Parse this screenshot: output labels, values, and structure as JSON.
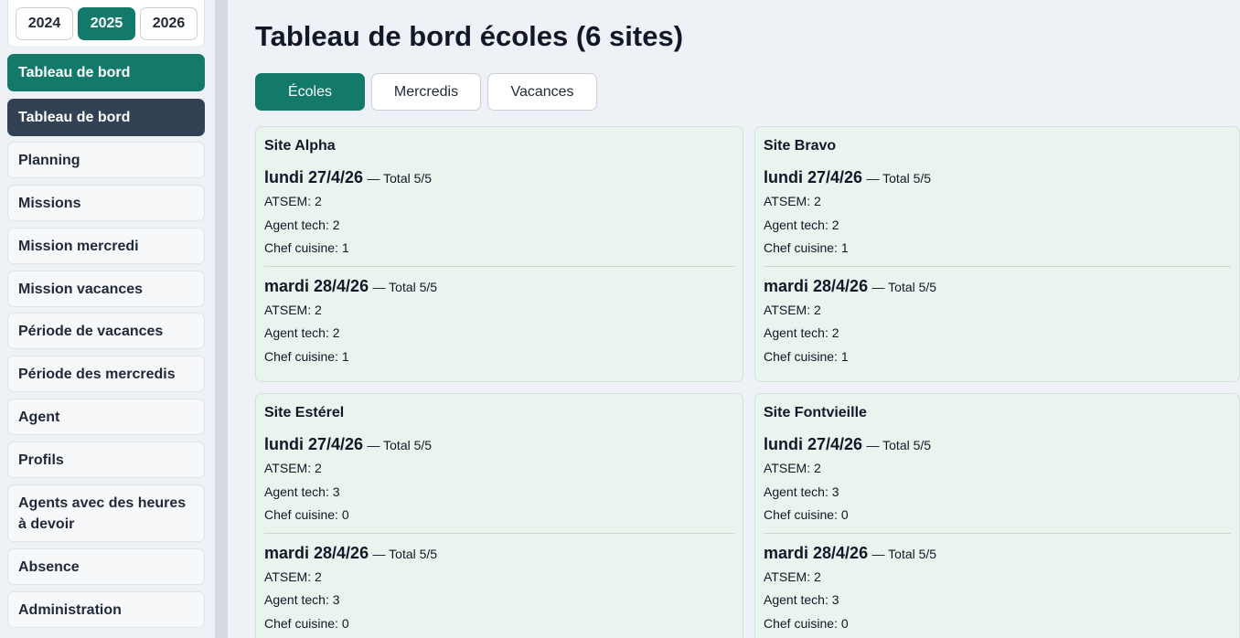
{
  "years": [
    "2024",
    "2025",
    "2026"
  ],
  "active_year": "2025",
  "sidebar": {
    "items": [
      {
        "label": "Tableau de bord",
        "style": "primary"
      },
      {
        "label": "Tableau de bord",
        "style": "dark"
      },
      {
        "label": "Planning",
        "style": "normal"
      },
      {
        "label": "Missions",
        "style": "normal"
      },
      {
        "label": "Mission mercredi",
        "style": "normal"
      },
      {
        "label": "Mission vacances",
        "style": "normal"
      },
      {
        "label": "Période de vacances",
        "style": "normal"
      },
      {
        "label": "Période des mercredis",
        "style": "normal"
      },
      {
        "label": "Agent",
        "style": "normal"
      },
      {
        "label": "Profils",
        "style": "normal"
      },
      {
        "label": "Agents avec des heures à devoir",
        "style": "normal"
      },
      {
        "label": "Absence",
        "style": "normal"
      },
      {
        "label": "Administration",
        "style": "normal"
      }
    ]
  },
  "page_title": "Tableau de bord écoles (6 sites)",
  "tabs": [
    {
      "label": "Écoles",
      "active": true
    },
    {
      "label": "Mercredis",
      "active": false
    },
    {
      "label": "Vacances",
      "active": false
    }
  ],
  "sites": [
    {
      "name": "Site Alpha",
      "days": [
        {
          "day": "lundi 27/4/26",
          "total": "— Total 5/5",
          "lines": [
            "ATSEM: 2",
            "Agent tech: 2",
            "Chef cuisine: 1"
          ]
        },
        {
          "day": "mardi 28/4/26",
          "total": "— Total 5/5",
          "lines": [
            "ATSEM: 2",
            "Agent tech: 2",
            "Chef cuisine: 1"
          ]
        }
      ]
    },
    {
      "name": "Site Bravo",
      "days": [
        {
          "day": "lundi 27/4/26",
          "total": "— Total 5/5",
          "lines": [
            "ATSEM: 2",
            "Agent tech: 2",
            "Chef cuisine: 1"
          ]
        },
        {
          "day": "mardi 28/4/26",
          "total": "— Total 5/5",
          "lines": [
            "ATSEM: 2",
            "Agent tech: 2",
            "Chef cuisine: 1"
          ]
        }
      ]
    },
    {
      "name": "Site Estérel",
      "days": [
        {
          "day": "lundi 27/4/26",
          "total": "— Total 5/5",
          "lines": [
            "ATSEM: 2",
            "Agent tech: 3",
            "Chef cuisine: 0"
          ]
        },
        {
          "day": "mardi 28/4/26",
          "total": "— Total 5/5",
          "lines": [
            "ATSEM: 2",
            "Agent tech: 3",
            "Chef cuisine: 0"
          ]
        }
      ]
    },
    {
      "name": "Site Fontvieille",
      "days": [
        {
          "day": "lundi 27/4/26",
          "total": "— Total 5/5",
          "lines": [
            "ATSEM: 2",
            "Agent tech: 3",
            "Chef cuisine: 0"
          ]
        },
        {
          "day": "mardi 28/4/26",
          "total": "— Total 5/5",
          "lines": [
            "ATSEM: 2",
            "Agent tech: 3",
            "Chef cuisine: 0"
          ]
        }
      ]
    }
  ],
  "colors": {
    "accent": "#137a6b",
    "dark": "#334155",
    "card_bg": "#e8f4ed",
    "page_bg": "#eef1f6"
  }
}
